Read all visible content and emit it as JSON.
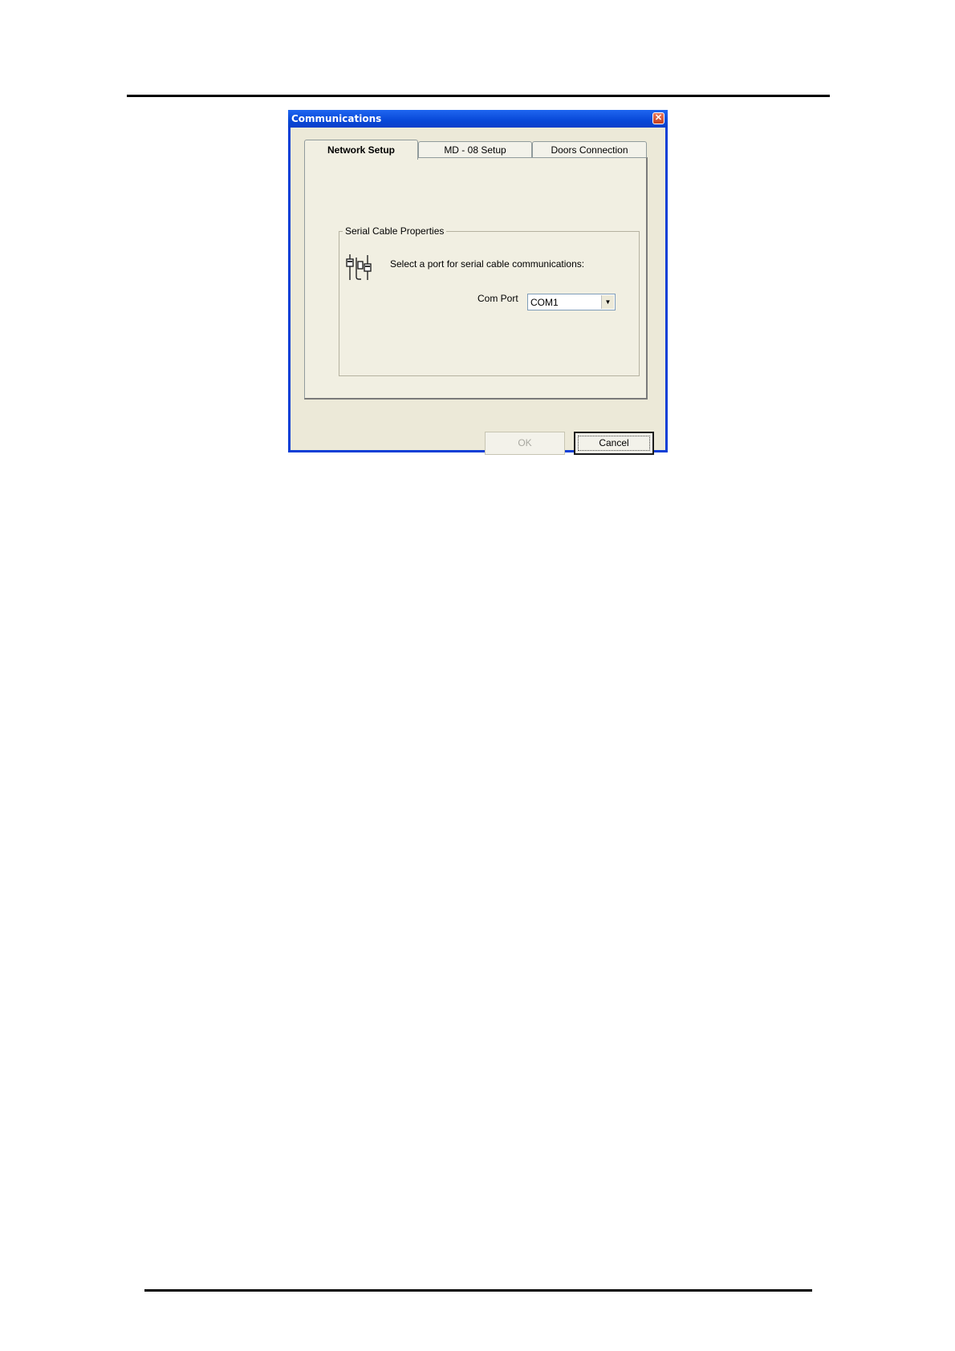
{
  "window": {
    "title": "Communications",
    "close_glyph": "✕"
  },
  "tabs": [
    {
      "label": "Network Setup",
      "active": true
    },
    {
      "label": "MD - 08 Setup",
      "active": false
    },
    {
      "label": "Doors Connection",
      "active": false
    }
  ],
  "group": {
    "legend": "Serial Cable Properties",
    "icon": "serial-cable-icon",
    "prompt": "Select a port for serial cable communications:",
    "com_port_label": "Com Port",
    "com_port_value": "COM1"
  },
  "buttons": {
    "ok": "OK",
    "cancel": "Cancel"
  },
  "colors": {
    "titlebar": "#0a3fd6",
    "dialog_bg": "#ece9d8"
  }
}
